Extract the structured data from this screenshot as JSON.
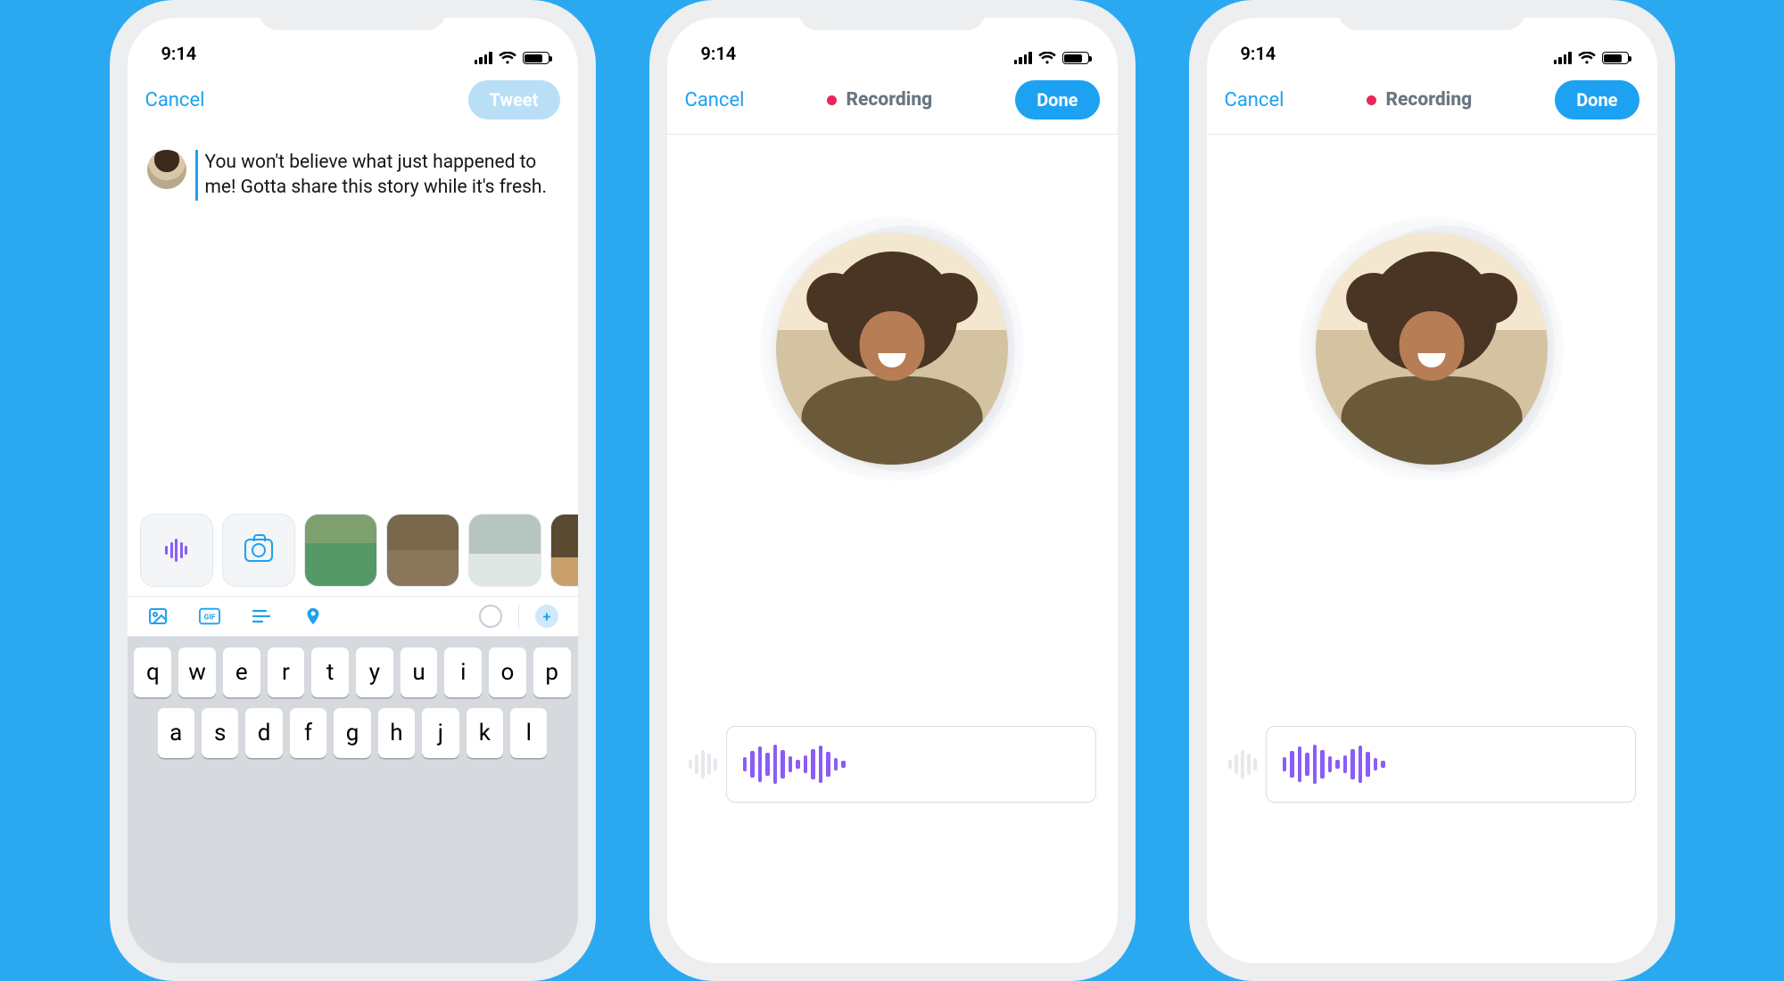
{
  "colors": {
    "accent": "#1da1f2",
    "bg": "#2aa9f0",
    "voice": "#8b5cf6",
    "rec": "#e8265a"
  },
  "status": {
    "time": "9:14"
  },
  "keyboard": {
    "row1": [
      "q",
      "w",
      "e",
      "r",
      "t",
      "y",
      "u",
      "i",
      "o",
      "p"
    ],
    "row2": [
      "a",
      "s",
      "d",
      "f",
      "g",
      "h",
      "j",
      "k",
      "l"
    ]
  },
  "screen1": {
    "cancel": "Cancel",
    "tweet": "Tweet",
    "compose_text": "You won't believe what just happened to me! Gotta share this story while it's fresh.",
    "media": {
      "voice": "voice-tweet",
      "camera": "camera"
    },
    "toolbar": {
      "image": "image",
      "gif": "GIF",
      "poll": "poll",
      "location": "location",
      "progress": "character-count",
      "add": "add-thread"
    }
  },
  "screen2": {
    "cancel": "Cancel",
    "status": "Recording",
    "done": "Done"
  },
  "screen3": {
    "cancel": "Cancel",
    "status": "Recording",
    "done": "Done"
  }
}
